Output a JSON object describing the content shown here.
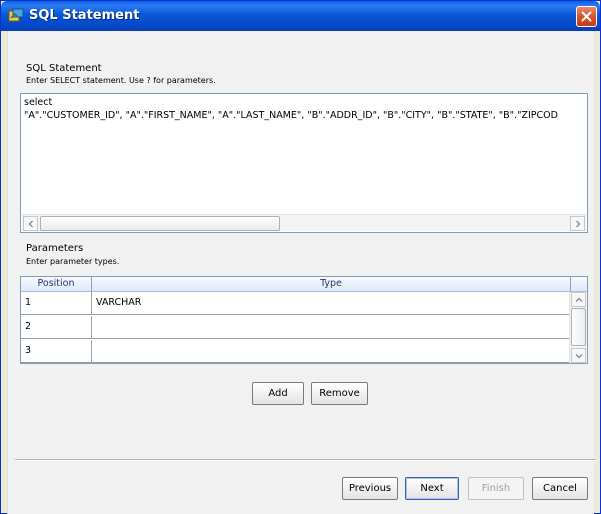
{
  "window": {
    "title": "SQL Statement"
  },
  "sql_section": {
    "title": "SQL Statement",
    "subtitle": "Enter SELECT statement.  Use ? for parameters.",
    "lines": [
      "select",
      "\"A\".\"CUSTOMER_ID\", \"A\".\"FIRST_NAME\", \"A\".\"LAST_NAME\", \"B\".\"ADDR_ID\", \"B\".\"CITY\", \"B\".\"STATE\", \"B\".\"ZIPCOD"
    ]
  },
  "params_section": {
    "title": "Parameters",
    "subtitle": "Enter parameter types.",
    "columns": [
      "Position",
      "Type"
    ],
    "rows": [
      {
        "position": "1",
        "type": "VARCHAR"
      },
      {
        "position": "2",
        "type": ""
      },
      {
        "position": "3",
        "type": ""
      }
    ],
    "add_label": "Add",
    "remove_label": "Remove"
  },
  "footer": {
    "previous_label": "Previous",
    "next_label": "Next",
    "finish_label": "Finish",
    "cancel_label": "Cancel"
  },
  "colors": {
    "titlebar": "#0a58d6",
    "window_bg": "#f1f1f1",
    "close_button": "#d9542c"
  }
}
